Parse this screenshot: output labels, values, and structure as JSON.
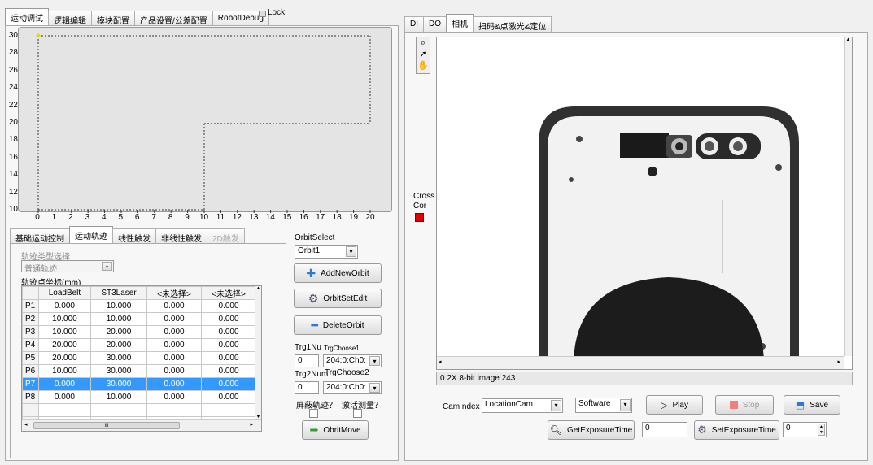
{
  "left_tabs": [
    "运动调试",
    "逻辑编辑",
    "模块配置",
    "产品设置/公差配置",
    "RobotDebug"
  ],
  "lock_label": "Lock",
  "plot": {
    "y_ticks": [
      "30",
      "28",
      "26",
      "24",
      "22",
      "20",
      "18",
      "16",
      "14",
      "12",
      "10"
    ],
    "x_ticks": [
      "0",
      "1",
      "2",
      "3",
      "4",
      "5",
      "6",
      "7",
      "8",
      "9",
      "10",
      "11",
      "12",
      "13",
      "14",
      "15",
      "16",
      "17",
      "18",
      "19",
      "20"
    ]
  },
  "sub_tabs": [
    "基础运动控制",
    "运动轨迹",
    "线性触发",
    "非线性触发",
    "2D触发"
  ],
  "orbit_type_label": "轨迹类型选择",
  "orbit_type_value": "普通轨迹",
  "orbit_coord_label": "轨迹点坐标(mm)",
  "table": {
    "headers": [
      "",
      "LoadBelt",
      "ST3Laser",
      "<未选择>",
      "<未选择>"
    ],
    "rows": [
      [
        "P1",
        "0.000",
        "10.000",
        "0.000",
        "0.000"
      ],
      [
        "P2",
        "10.000",
        "10.000",
        "0.000",
        "0.000"
      ],
      [
        "P3",
        "10.000",
        "20.000",
        "0.000",
        "0.000"
      ],
      [
        "P4",
        "20.000",
        "20.000",
        "0.000",
        "0.000"
      ],
      [
        "P5",
        "20.000",
        "30.000",
        "0.000",
        "0.000"
      ],
      [
        "P6",
        "10.000",
        "30.000",
        "0.000",
        "0.000"
      ],
      [
        "P7",
        "0.000",
        "30.000",
        "0.000",
        "0.000"
      ],
      [
        "P8",
        "0.000",
        "10.000",
        "0.000",
        "0.000"
      ]
    ],
    "scroll_mark": "III"
  },
  "orbit": {
    "select_label": "OrbitSelect",
    "select_value": "Orbit1",
    "add_label": "AddNewOrbit",
    "edit_label": "OrbitSetEdit",
    "delete_label": "DeleteOrbit",
    "trg1_label": "Trg1Nu",
    "trg1_choose_label": "TrgChoose1",
    "trg1_value": "0",
    "trg1_choose_value": "204:0:Ch0:",
    "trg2_label": "Trg2Num",
    "trg2_choose_label": "TrgChoose2",
    "trg2_value": "0",
    "trg2_choose_value": "204:0:Ch0:",
    "mask_label": "屏蔽轨迹？",
    "activate_label": "激活测量？",
    "move_label": "ObritMove"
  },
  "right_tabs": [
    "DI",
    "DO",
    "相机",
    "扫码&点激光&定位"
  ],
  "camera": {
    "cross_label": "Cross",
    "cor_label": "Cor",
    "status_text": "0.2X 8-bit image 243",
    "cam_index_label": "CamIndex",
    "cam_index_value": "LocationCam",
    "trigger_mode": "Software",
    "play_label": "Play",
    "stop_label": "Stop",
    "save_label": "Save",
    "get_exposure_label": "GetExposureTime",
    "get_exposure_value": "0",
    "set_exposure_label": "SetExposureTime",
    "set_exposure_value": "0"
  },
  "colors": {
    "selected_row": "#3399ff",
    "cross_red": "#e00000",
    "accent_blue": "#2b7bd6"
  }
}
